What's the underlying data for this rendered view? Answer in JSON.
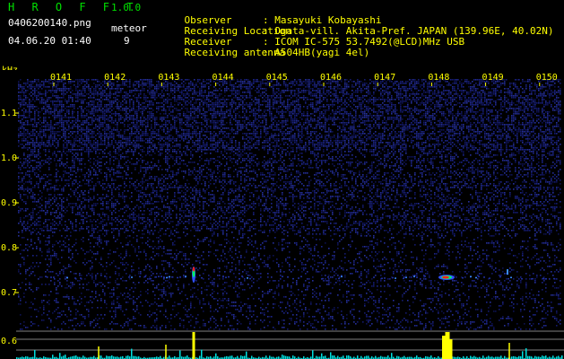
{
  "header": {
    "app_name": "H R O F F T",
    "version": "1.0.0",
    "file_name": "0406200140.png",
    "datetime": "04.06.20 01:40",
    "meteor_label": "meteor",
    "meteor_count": "9"
  },
  "station": [
    {
      "label": "Observer",
      "value": ": Masayuki Kobayashi"
    },
    {
      "label": "Receiving Location",
      "value": ": Ogata-vill. Akita-Pref. JAPAN (139.96E, 40.02N)"
    },
    {
      "label": "Receiver",
      "value": ": ICOM IC-575 53.7492(@LCD)MHz USB"
    },
    {
      "label": "Receiving antenna",
      "value": ": A504HB(yagi 4el)"
    }
  ],
  "spectrogram": {
    "freq_unit": "kHz",
    "time_labels": [
      "0141",
      "0142",
      "0143",
      "0144",
      "0145",
      "0146",
      "0147",
      "0148",
      "0149",
      "0150"
    ],
    "freq_labels": [
      "1.1",
      "1.0",
      "0.9",
      "0.8",
      "0.7"
    ],
    "lower_freq_label": "0.6",
    "colors": {
      "background": "#000000",
      "noise": "#141a6e",
      "tick_label": "#ffff00",
      "lower_panel_line": "#ffffff",
      "signal_bar": "#ffff00",
      "trace": "#00e0e0",
      "echo_hot": "#ff2020",
      "echo_mid": "#00ff60"
    }
  }
}
